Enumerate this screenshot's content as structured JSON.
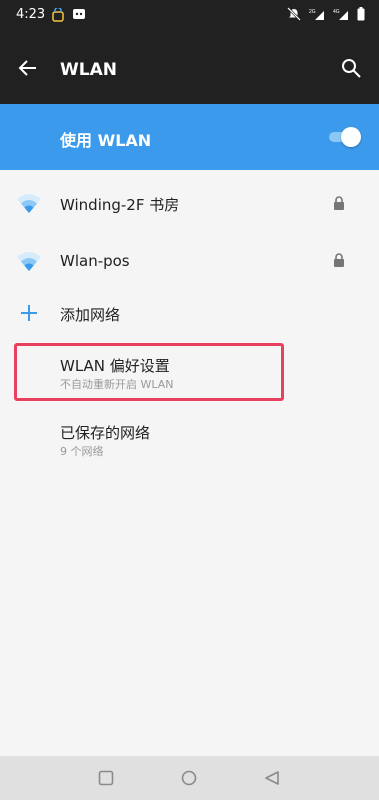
{
  "status_bar": {
    "time": "4:23",
    "icons_left": [
      "notification-app-icon",
      "notification-message-icon"
    ],
    "icons_right": [
      "mute-icon",
      "signal-icon",
      "4g-signal-icon",
      "battery-icon"
    ]
  },
  "app_bar": {
    "title": "WLAN",
    "back_icon": "arrow-left-icon",
    "search_icon": "search-icon"
  },
  "master_switch": {
    "label": "使用 WLAN",
    "enabled": true,
    "accent_color": "#3b9aeb"
  },
  "networks": [
    {
      "ssid": "Winding-2F 书房",
      "secured": true
    },
    {
      "ssid": "Wlan-pos",
      "secured": true
    }
  ],
  "add_network": {
    "label": "添加网络"
  },
  "preferences": {
    "title": "WLAN 偏好设置",
    "subtitle": "不自动重新开启 WLAN"
  },
  "saved_networks": {
    "title": "已保存的网络",
    "subtitle": "9 个网络"
  },
  "highlight_color": "#e8405e",
  "nav_bar": {
    "buttons": [
      "recent-apps-icon",
      "home-icon",
      "back-icon"
    ]
  }
}
